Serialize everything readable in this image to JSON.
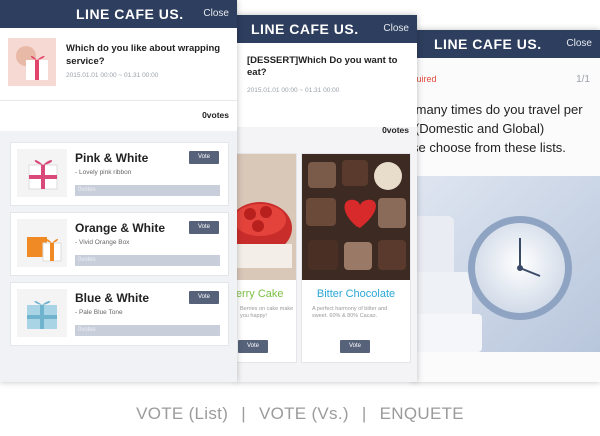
{
  "enquete": {
    "header_title": "LINE CAFE US.",
    "close_label": "Close",
    "required_label": "Required",
    "page_counter": "1/1",
    "question_text": "How many times do you travel per year (Domestic and Global) Please choose from these lists."
  },
  "vs": {
    "header_title": "LINE CAFE US.",
    "close_label": "Close",
    "question": "[DESSERT]Which Do you want to eat?",
    "date_range": "2015.01.01 00:00 ~ 01.31 00:00",
    "vote_count": "0votes",
    "options": [
      {
        "title": "Berry Cake",
        "desc": "Berries on cake make you happy!",
        "vote_label": "Vote",
        "color": "#7cc043"
      },
      {
        "title": "Bitter Chocolate",
        "desc": "A perfect harmony of bitter and sweet. 60% & 80% Cacao.",
        "vote_label": "Vote",
        "color": "#2aa7d6"
      }
    ]
  },
  "list": {
    "header_title": "LINE CAFE US.",
    "close_label": "Close",
    "question": "Which do you like about wrapping service?",
    "date_range": "2015.01.01 00:00 ~ 01.31 00:00",
    "vote_count": "0votes",
    "items": [
      {
        "title": "Pink & White",
        "desc": "- Lovely pink ribbon",
        "vote_label": "Vote",
        "bar_label": "0votes"
      },
      {
        "title": "Orange & White",
        "desc": "- Vivid Orange Box",
        "vote_label": "Vote",
        "bar_label": "0votes"
      },
      {
        "title": "Blue & White",
        "desc": "- Pale Blue Tone",
        "vote_label": "Vote",
        "bar_label": "0votes"
      }
    ]
  },
  "caption": {
    "items": [
      "VOTE (List)",
      "VOTE (Vs.)",
      "ENQUETE"
    ],
    "separator": "|"
  }
}
